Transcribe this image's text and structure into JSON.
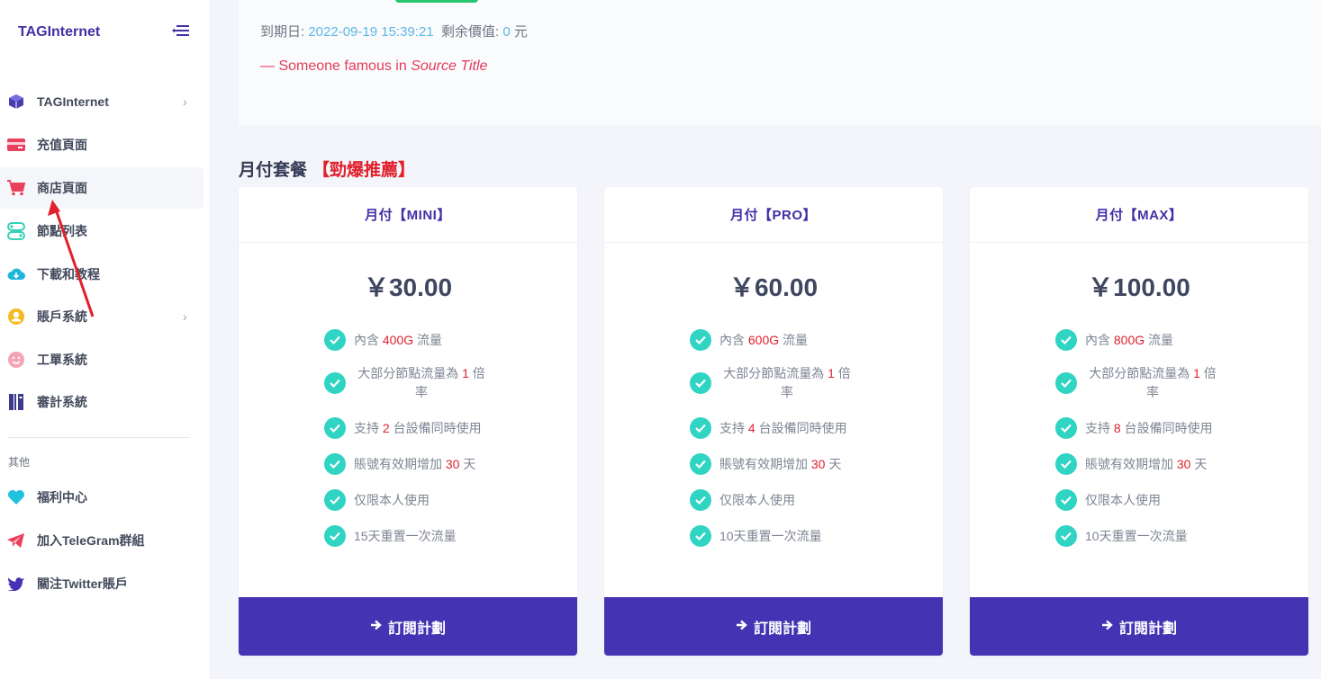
{
  "sidebar": {
    "brand": "TAGInternet",
    "items": [
      {
        "label": "TAGInternet",
        "icon": "cube-icon",
        "chevron": "›"
      },
      {
        "label": "充值頁面",
        "icon": "credit-card-icon"
      },
      {
        "label": "商店頁面",
        "icon": "cart-icon",
        "active": true
      },
      {
        "label": "節點列表",
        "icon": "nodes-icon"
      },
      {
        "label": "下載和教程",
        "icon": "cloud-download-icon"
      },
      {
        "label": "賬戶系統",
        "icon": "user-circle-icon",
        "chevron": "›"
      },
      {
        "label": "工單系統",
        "icon": "smile-face-icon"
      },
      {
        "label": "審計系統",
        "icon": "audit-icon"
      }
    ],
    "other_label": "其他",
    "other_items": [
      {
        "label": "福利中心",
        "icon": "heart-icon"
      },
      {
        "label": "加入TeleGram群組",
        "icon": "telegram-icon"
      },
      {
        "label": "關注Twitter賬戶",
        "icon": "twitter-icon"
      }
    ]
  },
  "account": {
    "expire_label": "到期日:",
    "expire_value": "2022-09-19 15:39:21",
    "balance_label": "剩余價值:",
    "balance_value": "0",
    "balance_unit": "元",
    "quote_prefix": "— Someone famous in",
    "quote_source": "Source Title"
  },
  "plans_section": {
    "title": "月付套餐",
    "badge": "【勁爆推薦】"
  },
  "plans": [
    {
      "name": "月付【MINI】",
      "price": "￥30.00",
      "traffic": "400G",
      "rate": "1",
      "devices": "2",
      "days": "30",
      "reset": "15天重置一次流量",
      "button": "訂閱計劃"
    },
    {
      "name": "月付【PRO】",
      "price": "￥60.00",
      "traffic": "600G",
      "rate": "1",
      "devices": "4",
      "days": "30",
      "reset": "10天重置一次流量",
      "button": "訂閱計劃"
    },
    {
      "name": "月付【MAX】",
      "price": "￥100.00",
      "traffic": "800G",
      "rate": "1",
      "devices": "8",
      "days": "30",
      "reset": "10天重置一次流量",
      "button": "訂閱計劃"
    }
  ],
  "feature_text": {
    "traffic_prefix": "內含",
    "traffic_suffix": "流量",
    "rate_prefix": "大部分節點流量為",
    "rate_suffix_a": "倍",
    "rate_suffix_b": "率",
    "devices_prefix": "支持",
    "devices_suffix": "台設備同時使用",
    "days_prefix": "賬號有效期增加",
    "days_suffix": "天",
    "self_only": "仅限本人使用"
  },
  "colors": {
    "brand": "#4230a6",
    "button": "#4433b3",
    "check": "#2fd4c3",
    "highlight": "#e0202c"
  }
}
